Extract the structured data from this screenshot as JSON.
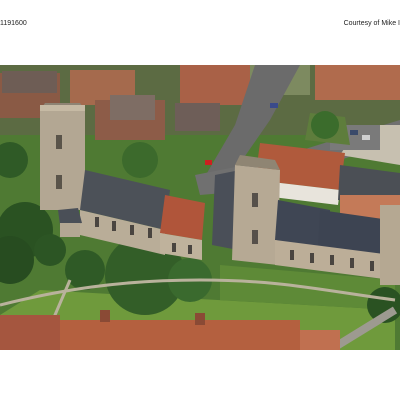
{
  "header": {
    "left_text": "1191600",
    "right_text": "Courtesy of Mike I"
  },
  "photo": {
    "subject": "aerial-photo-church-village",
    "colors": {
      "grass": "#4f7a33",
      "roof_slate": "#4a4f57",
      "roof_tile": "#b0553a",
      "stone": "#b9ad98",
      "road": "#6b6b6b"
    }
  }
}
